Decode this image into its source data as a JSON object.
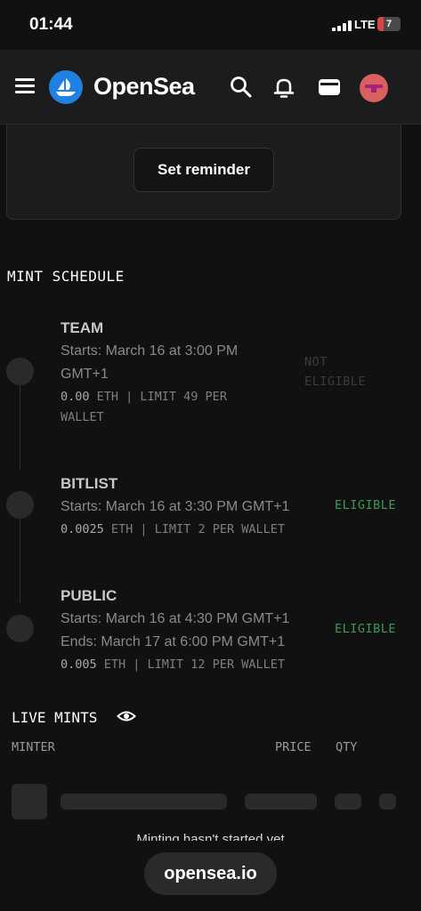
{
  "status_bar": {
    "time": "01:44",
    "network": "LTE",
    "battery": "7",
    "battery_color": "#d9434a"
  },
  "nav": {
    "brand": "OpenSea",
    "brand_color": "#2081e2",
    "icons": [
      "menu-icon",
      "opensea-logo-icon",
      "search-icon",
      "bell-icon",
      "wallet-icon",
      "avatar"
    ]
  },
  "reminder": {
    "button_label": "Set reminder"
  },
  "mint_schedule": {
    "title": "MINT SCHEDULE",
    "phases": [
      {
        "name": "TEAM",
        "starts": "Starts: March 16 at 3:00 PM GMT+1",
        "starts_line1": "Starts: March 16 at 3:00 PM",
        "starts_line2": "GMT+1",
        "price": "0.00",
        "details": " ETH | LIMIT 49 PER",
        "details_line2": "WALLET",
        "eligibility": "NOT ELIGIBLE",
        "eligibility_line1": "NOT",
        "eligibility_line2": "ELIGIBLE"
      },
      {
        "name": "BITLIST",
        "starts": "Starts: March 16 at 3:30 PM GMT+1",
        "price": "0.0025",
        "details": " ETH | LIMIT 2 PER WALLET",
        "eligibility": "ELIGIBLE"
      },
      {
        "name": "PUBLIC",
        "starts": "Starts: March 16 at 4:30 PM GMT+1",
        "ends": "Ends: March 17 at 6:00 PM GMT+1",
        "price": "0.005",
        "details": " ETH | LIMIT 12 PER WALLET",
        "eligibility": "ELIGIBLE"
      }
    ],
    "eligible_color": "#3a9a54"
  },
  "live_mints": {
    "title": "LIVE MINTS",
    "columns": [
      "MINTER",
      "PRICE",
      "QTY"
    ],
    "empty_message": "Minting hasn't started yet"
  },
  "browser": {
    "url": "opensea.io"
  }
}
